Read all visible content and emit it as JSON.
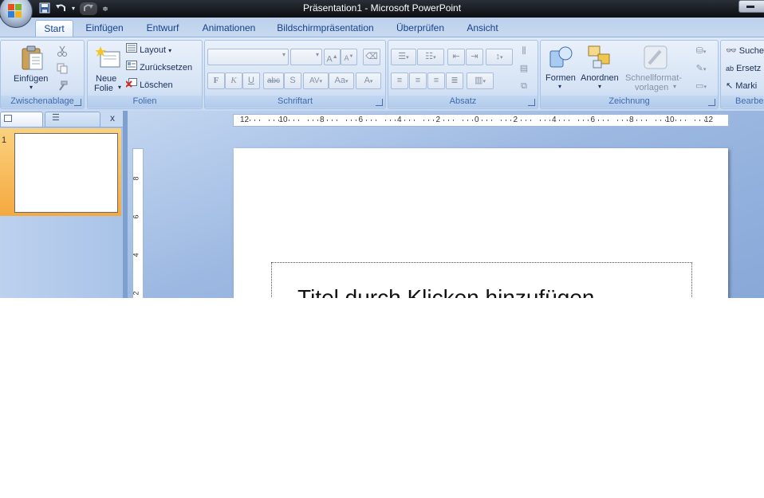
{
  "window": {
    "title": "Präsentation1 - Microsoft PowerPoint"
  },
  "quick_access": {
    "icons": [
      "save-icon",
      "undo-icon",
      "redo-icon",
      "customize-icon"
    ]
  },
  "tabs": [
    {
      "label": "Start",
      "active": true
    },
    {
      "label": "Einfügen"
    },
    {
      "label": "Entwurf"
    },
    {
      "label": "Animationen"
    },
    {
      "label": "Bildschirmpräsentation"
    },
    {
      "label": "Überprüfen"
    },
    {
      "label": "Ansicht"
    }
  ],
  "ribbon": {
    "clipboard": {
      "label": "Zwischenablage",
      "paste": "Einfügen"
    },
    "slides": {
      "label": "Folien",
      "new_slide_line1": "Neue",
      "new_slide_line2": "Folie",
      "layout": "Layout",
      "reset": "Zurücksetzen",
      "delete": "Löschen"
    },
    "font": {
      "label": "Schriftart",
      "font_name": "",
      "font_size": "",
      "bold": "F",
      "italic": "K",
      "underline": "U",
      "strike": "abc",
      "shadow": "S",
      "spacing": "AV",
      "case": "Aa",
      "color": "A",
      "grow": "A",
      "shrink": "A"
    },
    "paragraph": {
      "label": "Absatz"
    },
    "drawing": {
      "label": "Zeichnung",
      "shapes": "Formen",
      "arrange": "Anordnen",
      "quickstyles_line1": "Schnellformat-",
      "quickstyles_line2": "vorlagen"
    },
    "editing": {
      "label": "Bearbe",
      "find": "Suche",
      "replace": "Ersetz",
      "select": "Marki"
    }
  },
  "slide_pane": {
    "close": "x",
    "slide_number": "1"
  },
  "ruler": {
    "h_labels": [
      "12",
      "10",
      "8",
      "6",
      "4",
      "2",
      "0",
      "2",
      "4",
      "6",
      "8",
      "10",
      "12"
    ],
    "v_labels": [
      "8",
      "6",
      "4",
      "2"
    ]
  },
  "slide": {
    "title_placeholder": "Titel durch Klicken hinzufügen"
  },
  "colors": {
    "accent": "#15428b",
    "selected_thumb": "#f4a93f"
  }
}
